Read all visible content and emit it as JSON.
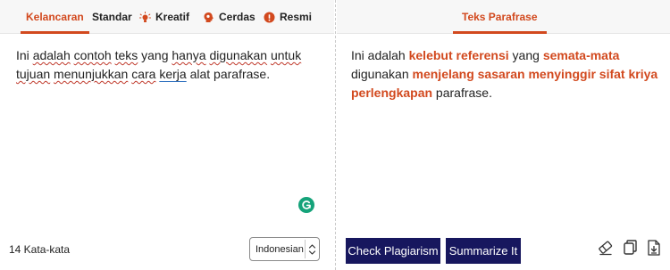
{
  "left": {
    "tabs": [
      {
        "label": "Kelancaran",
        "icon": null,
        "active": true
      },
      {
        "label": "Standar",
        "icon": null,
        "active": false
      },
      {
        "label": "Kreatif",
        "icon": "lightbulb-icon",
        "active": false
      },
      {
        "label": "Cerdas",
        "icon": "brain-icon",
        "active": false
      },
      {
        "label": "Resmi",
        "icon": "info-icon",
        "active": false
      }
    ],
    "input_segments": [
      "Ini ",
      "adalah",
      " ",
      "contoh",
      " ",
      "teks",
      " yang ",
      "hanya",
      " ",
      "digunakan",
      " ",
      "untuk",
      " ",
      "tujuan",
      " ",
      "menunjukkan",
      " ",
      "cara",
      " ",
      "kerja",
      " alat parafrase."
    ],
    "word_count": "14 Kata-kata",
    "language": "Indonesian"
  },
  "right": {
    "tab_label": "Teks Parafrase",
    "output_segments": [
      {
        "text": "Ini adalah ",
        "changed": false
      },
      {
        "text": "kelebut referensi",
        "changed": true
      },
      {
        "text": " yang ",
        "changed": false
      },
      {
        "text": "semata-mata",
        "changed": true
      },
      {
        "text": " digunakan ",
        "changed": false
      },
      {
        "text": "menjelang sasaran menyinggir sifat kriya perlengkapan",
        "changed": true
      },
      {
        "text": " parafrase.",
        "changed": false
      }
    ],
    "buttons": {
      "check_plagiarism": "Check Plagiarism",
      "summarize": "Summarize It"
    },
    "tool_icons": [
      "eraser-icon",
      "copy-icon",
      "download-icon"
    ]
  },
  "colors": {
    "accent": "#d2491e",
    "button": "#17175e",
    "grammarly": "#15a37a"
  }
}
